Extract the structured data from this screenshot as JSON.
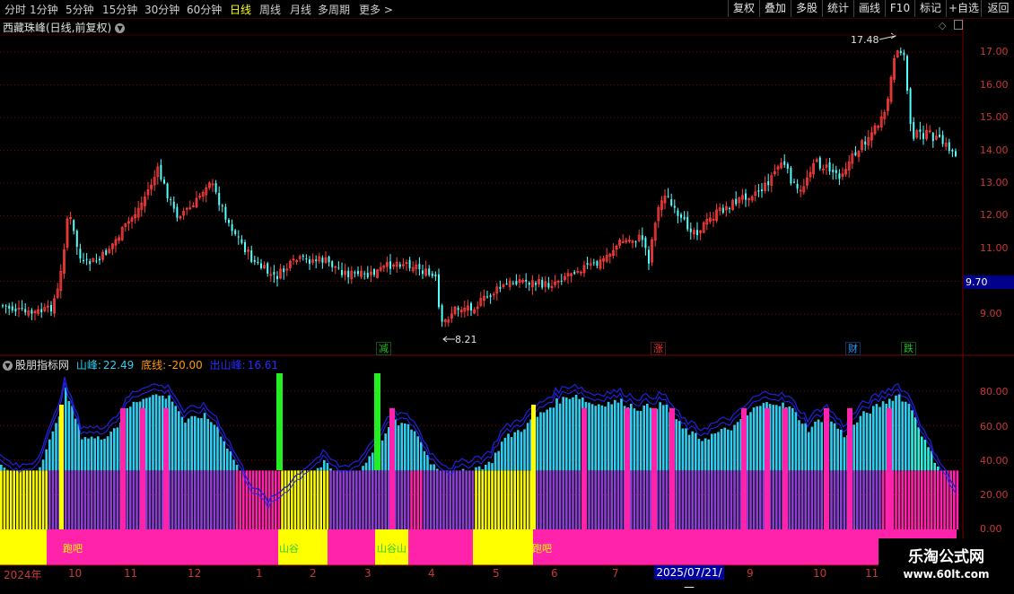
{
  "toolbar": {
    "periods": [
      "分时",
      "1分钟",
      "5分钟",
      "15分钟",
      "30分钟",
      "60分钟",
      "日线",
      "周线",
      "月线",
      "多周期",
      "更多 >"
    ],
    "active_period": "日线",
    "buttons": [
      "复权",
      "叠加",
      "多股",
      "统计",
      "画线",
      "F10",
      "+自选",
      "返回"
    ]
  },
  "stock": {
    "title": "西藏珠峰(日线,前复权)",
    "current_price": "9.70",
    "high_label": "17.48",
    "low_label": "8.21",
    "price_axis": [
      "17.00",
      "16.00",
      "15.00",
      "14.00",
      "13.00",
      "12.00",
      "11.00",
      "9.00"
    ]
  },
  "signals": [
    {
      "text": "减",
      "color": "#20c020"
    },
    {
      "text": "涨",
      "color": "#ff3030"
    },
    {
      "text": "财",
      "color": "#20a0ff"
    },
    {
      "text": "跌",
      "color": "#20c020"
    }
  ],
  "indicator": {
    "name": "股朋指标网",
    "shanfeng_label": "山峰:",
    "shanfeng_value": "22.49",
    "dixian_label": "底线:",
    "dixian_value": "-20.00",
    "chushanfeng_label": "出山峰:",
    "chushanfeng_value": "16.61",
    "axis": [
      "80.00",
      "60.00",
      "40.00",
      "20.00",
      "0.00"
    ],
    "band_labels": [
      "跑吧",
      "山谷",
      "山谷山",
      "跑吧"
    ]
  },
  "dates": [
    "2024年",
    "10",
    "11",
    "12",
    "1",
    "2",
    "3",
    "4",
    "5",
    "6",
    "7",
    "9",
    "10",
    "11"
  ],
  "cursor_date": "2025/07/21/—",
  "watermark": {
    "line1": "乐淘公式网",
    "line2": "www.60lt.com"
  },
  "colors": {
    "up": "#ff3c3c",
    "down": "#54ffff",
    "grid": "#8a0000",
    "border": "#7a0000",
    "magenta": "#ff22aa",
    "yellow": "#ffff00",
    "purple": "#8a3fd0",
    "cyan": "#33ccee",
    "navy": "#1f1fd0",
    "green": "#22ee22"
  }
}
